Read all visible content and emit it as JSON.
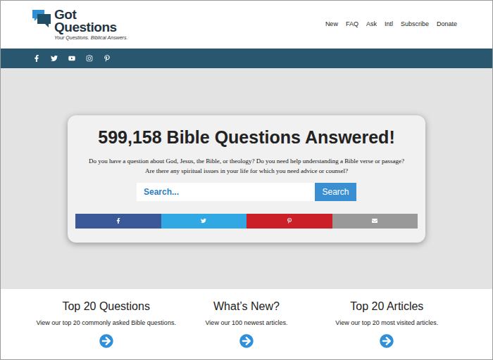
{
  "header": {
    "logo": {
      "lines": [
        "Got",
        "Questions"
      ],
      "tagline": "Your Questions. Biblical Answers."
    },
    "nav": [
      "New",
      "FAQ",
      "Ask",
      "Intl",
      "Subscribe",
      "Donate"
    ]
  },
  "hero": {
    "title": "599,158 Bible Questions Answered!",
    "description": [
      "Do you have a question about God, Jesus, the Bible, or theology? Do you need help understanding a Bible verse or passage?",
      "Are there any spiritual issues in your life for which you need advice or counsel?"
    ],
    "search": {
      "placeholder": "Search...",
      "button": "Search"
    },
    "share": [
      {
        "color": "#3b5998"
      },
      {
        "color": "#2fa8e3"
      },
      {
        "color": "#cb2027"
      },
      {
        "color": "#999999"
      }
    ]
  },
  "features": [
    {
      "title": "Top 20 Questions",
      "description": "View our top 20 commonly asked Bible questions."
    },
    {
      "title": "What’s New?",
      "description": "View our 100 newest articles."
    },
    {
      "title": "Top 20 Articles",
      "description": "View our top 20 most visited articles."
    }
  ]
}
